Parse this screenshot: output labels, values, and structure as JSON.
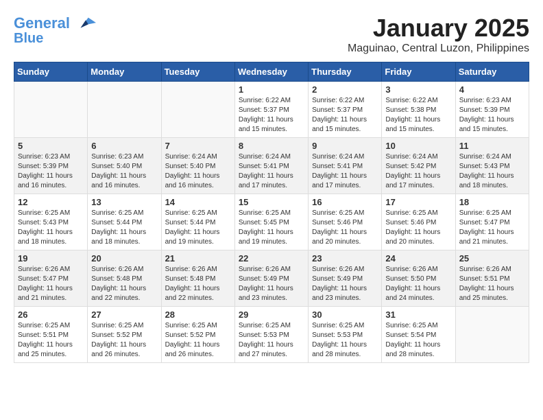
{
  "header": {
    "logo_line1": "General",
    "logo_line2": "Blue",
    "month": "January 2025",
    "location": "Maguinao, Central Luzon, Philippines"
  },
  "weekdays": [
    "Sunday",
    "Monday",
    "Tuesday",
    "Wednesday",
    "Thursday",
    "Friday",
    "Saturday"
  ],
  "weeks": [
    {
      "shaded": false,
      "days": [
        {
          "num": "",
          "info": ""
        },
        {
          "num": "",
          "info": ""
        },
        {
          "num": "",
          "info": ""
        },
        {
          "num": "1",
          "info": "Sunrise: 6:22 AM\nSunset: 5:37 PM\nDaylight: 11 hours\nand 15 minutes."
        },
        {
          "num": "2",
          "info": "Sunrise: 6:22 AM\nSunset: 5:37 PM\nDaylight: 11 hours\nand 15 minutes."
        },
        {
          "num": "3",
          "info": "Sunrise: 6:22 AM\nSunset: 5:38 PM\nDaylight: 11 hours\nand 15 minutes."
        },
        {
          "num": "4",
          "info": "Sunrise: 6:23 AM\nSunset: 5:39 PM\nDaylight: 11 hours\nand 15 minutes."
        }
      ]
    },
    {
      "shaded": true,
      "days": [
        {
          "num": "5",
          "info": "Sunrise: 6:23 AM\nSunset: 5:39 PM\nDaylight: 11 hours\nand 16 minutes."
        },
        {
          "num": "6",
          "info": "Sunrise: 6:23 AM\nSunset: 5:40 PM\nDaylight: 11 hours\nand 16 minutes."
        },
        {
          "num": "7",
          "info": "Sunrise: 6:24 AM\nSunset: 5:40 PM\nDaylight: 11 hours\nand 16 minutes."
        },
        {
          "num": "8",
          "info": "Sunrise: 6:24 AM\nSunset: 5:41 PM\nDaylight: 11 hours\nand 17 minutes."
        },
        {
          "num": "9",
          "info": "Sunrise: 6:24 AM\nSunset: 5:41 PM\nDaylight: 11 hours\nand 17 minutes."
        },
        {
          "num": "10",
          "info": "Sunrise: 6:24 AM\nSunset: 5:42 PM\nDaylight: 11 hours\nand 17 minutes."
        },
        {
          "num": "11",
          "info": "Sunrise: 6:24 AM\nSunset: 5:43 PM\nDaylight: 11 hours\nand 18 minutes."
        }
      ]
    },
    {
      "shaded": false,
      "days": [
        {
          "num": "12",
          "info": "Sunrise: 6:25 AM\nSunset: 5:43 PM\nDaylight: 11 hours\nand 18 minutes."
        },
        {
          "num": "13",
          "info": "Sunrise: 6:25 AM\nSunset: 5:44 PM\nDaylight: 11 hours\nand 18 minutes."
        },
        {
          "num": "14",
          "info": "Sunrise: 6:25 AM\nSunset: 5:44 PM\nDaylight: 11 hours\nand 19 minutes."
        },
        {
          "num": "15",
          "info": "Sunrise: 6:25 AM\nSunset: 5:45 PM\nDaylight: 11 hours\nand 19 minutes."
        },
        {
          "num": "16",
          "info": "Sunrise: 6:25 AM\nSunset: 5:46 PM\nDaylight: 11 hours\nand 20 minutes."
        },
        {
          "num": "17",
          "info": "Sunrise: 6:25 AM\nSunset: 5:46 PM\nDaylight: 11 hours\nand 20 minutes."
        },
        {
          "num": "18",
          "info": "Sunrise: 6:25 AM\nSunset: 5:47 PM\nDaylight: 11 hours\nand 21 minutes."
        }
      ]
    },
    {
      "shaded": true,
      "days": [
        {
          "num": "19",
          "info": "Sunrise: 6:26 AM\nSunset: 5:47 PM\nDaylight: 11 hours\nand 21 minutes."
        },
        {
          "num": "20",
          "info": "Sunrise: 6:26 AM\nSunset: 5:48 PM\nDaylight: 11 hours\nand 22 minutes."
        },
        {
          "num": "21",
          "info": "Sunrise: 6:26 AM\nSunset: 5:48 PM\nDaylight: 11 hours\nand 22 minutes."
        },
        {
          "num": "22",
          "info": "Sunrise: 6:26 AM\nSunset: 5:49 PM\nDaylight: 11 hours\nand 23 minutes."
        },
        {
          "num": "23",
          "info": "Sunrise: 6:26 AM\nSunset: 5:49 PM\nDaylight: 11 hours\nand 23 minutes."
        },
        {
          "num": "24",
          "info": "Sunrise: 6:26 AM\nSunset: 5:50 PM\nDaylight: 11 hours\nand 24 minutes."
        },
        {
          "num": "25",
          "info": "Sunrise: 6:26 AM\nSunset: 5:51 PM\nDaylight: 11 hours\nand 25 minutes."
        }
      ]
    },
    {
      "shaded": false,
      "days": [
        {
          "num": "26",
          "info": "Sunrise: 6:25 AM\nSunset: 5:51 PM\nDaylight: 11 hours\nand 25 minutes."
        },
        {
          "num": "27",
          "info": "Sunrise: 6:25 AM\nSunset: 5:52 PM\nDaylight: 11 hours\nand 26 minutes."
        },
        {
          "num": "28",
          "info": "Sunrise: 6:25 AM\nSunset: 5:52 PM\nDaylight: 11 hours\nand 26 minutes."
        },
        {
          "num": "29",
          "info": "Sunrise: 6:25 AM\nSunset: 5:53 PM\nDaylight: 11 hours\nand 27 minutes."
        },
        {
          "num": "30",
          "info": "Sunrise: 6:25 AM\nSunset: 5:53 PM\nDaylight: 11 hours\nand 28 minutes."
        },
        {
          "num": "31",
          "info": "Sunrise: 6:25 AM\nSunset: 5:54 PM\nDaylight: 11 hours\nand 28 minutes."
        },
        {
          "num": "",
          "info": ""
        }
      ]
    }
  ]
}
